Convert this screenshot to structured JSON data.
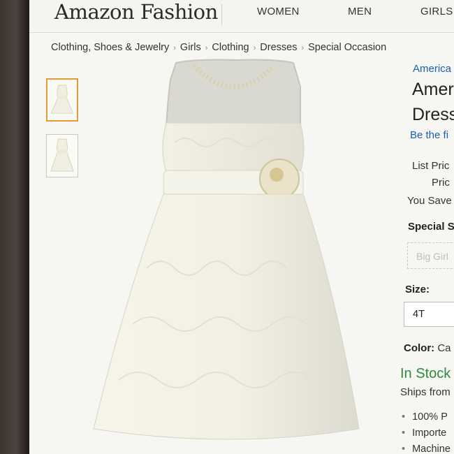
{
  "header": {
    "logo": "Amazon Fashion",
    "nav": [
      "WOMEN",
      "MEN",
      "GIRLS"
    ]
  },
  "breadcrumb": [
    "Clothing, Shoes & Jewelry",
    "Girls",
    "Clothing",
    "Dresses",
    "Special Occasion"
  ],
  "product": {
    "brand": "America",
    "title_line1": "Amer",
    "title_line2": "Dress",
    "review_prompt": "Be the fi",
    "list_price_label": "List Pric",
    "price_label": "Pric",
    "you_save_label": "You Save",
    "special_label": "Special S",
    "special_placeholder": "Big Girl",
    "size_label": "Size:",
    "size_value": "4T",
    "color_label": "Color:",
    "color_value": "Ca",
    "availability": "In Stock",
    "ships_from": "Ships from",
    "bullets": [
      "100% P",
      "Importe",
      "Machine"
    ]
  },
  "colors": {
    "link": "#1a5fb4",
    "in_stock": "#2e8b3e",
    "thumb_selected_border": "#e29a3b"
  }
}
